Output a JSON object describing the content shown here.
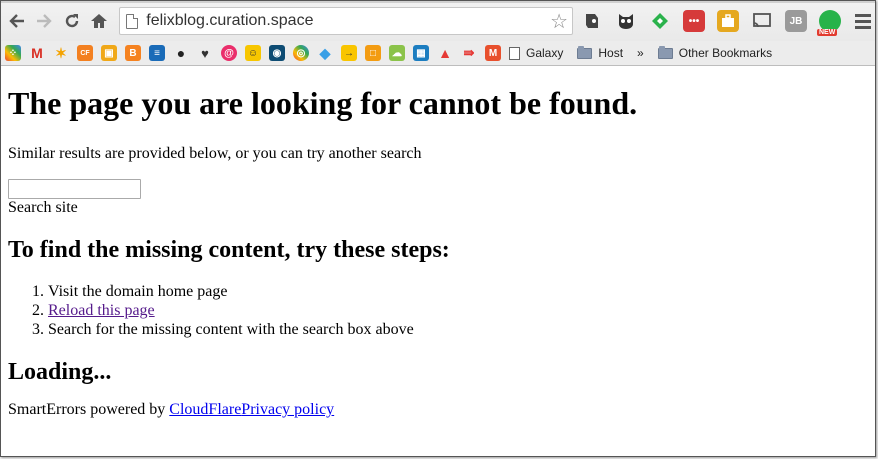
{
  "browser": {
    "url": "felixblog.curation.space",
    "bookmarks": [
      {
        "label": "Galaxy",
        "type": "page"
      },
      {
        "label": "Host",
        "type": "folder"
      }
    ],
    "overflow_label": "»",
    "other_bookmarks": "Other Bookmarks"
  },
  "page": {
    "heading": "The page you are looking for cannot be found.",
    "subtitle": "Similar results are provided below, or you can try another search",
    "search": {
      "value": "",
      "label": "Search site"
    },
    "steps_heading": "To find the missing content, try these steps:",
    "steps": [
      "Visit the domain home page",
      "Reload this page",
      "Search for the missing content with the search box above"
    ],
    "loading": "Loading...",
    "footer": {
      "prefix": "SmartErrors powered by ",
      "link1": "CloudFlare",
      "link2": "Privacy policy"
    }
  },
  "colors": {
    "visited_link": "#551a8b",
    "link": "#0000ee"
  }
}
